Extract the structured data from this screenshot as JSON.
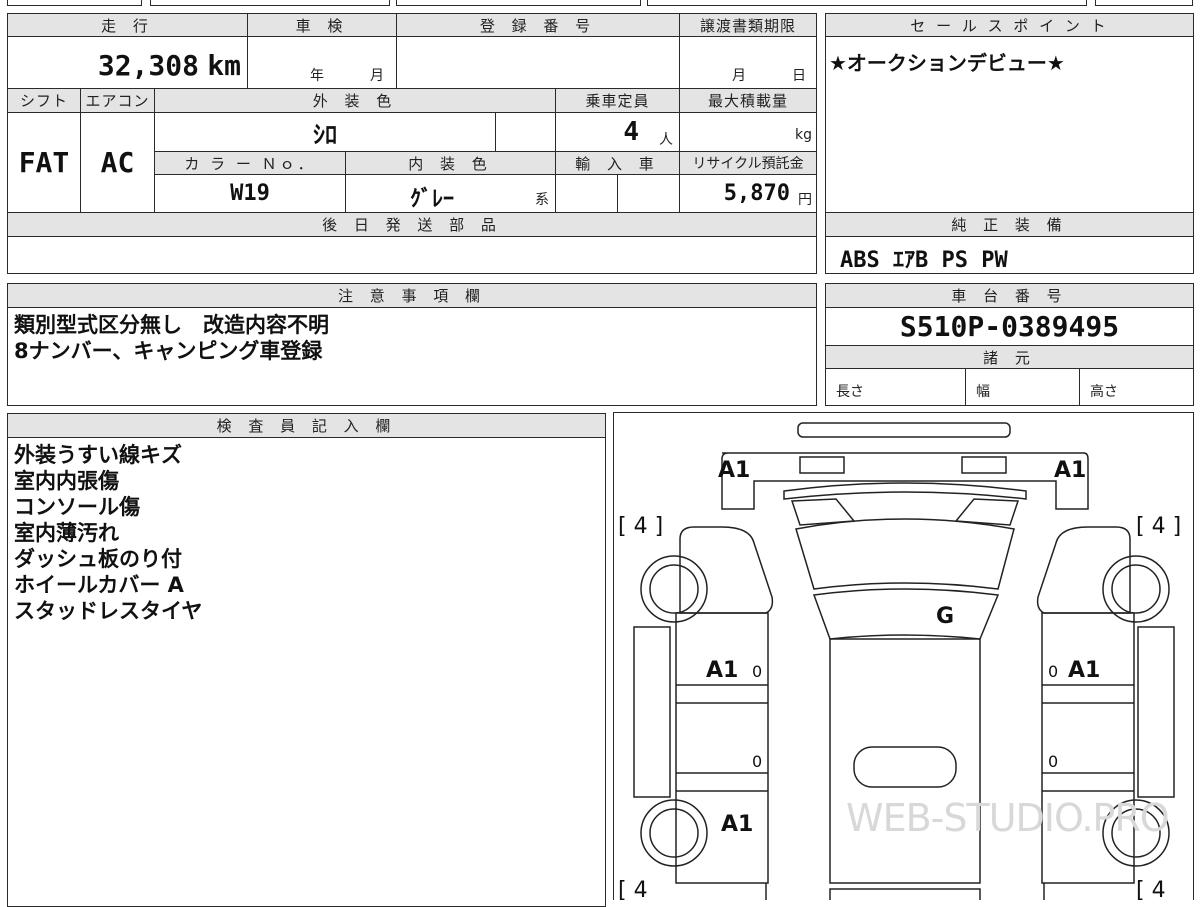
{
  "top_row": {
    "mileage_header": "走 行",
    "shaken_header": "車 検",
    "registration_header": "登 録 番 号",
    "deadline_header": "譲渡書類期限",
    "mileage_value": "32,308",
    "mileage_unit": "km",
    "shaken_year": "年",
    "shaken_month": "月",
    "deadline_month": "月",
    "deadline_day": "日"
  },
  "second_row": {
    "shift_header": "シフト",
    "ac_header": "エアコン",
    "exterior_color_header": "外 装 色",
    "capacity_header": "乗車定員",
    "max_load_header": "最大積載量",
    "shift_value": "FAT",
    "ac_value": "AC",
    "exterior_color_value": "ｼﾛ",
    "capacity_value": "4",
    "capacity_unit": "人",
    "max_load_unit": "kg",
    "color_no_header": "カ ラ ー Ｎｏ．",
    "interior_color_header": "内 装 色",
    "import_header": "輸 入 車",
    "recycle_header": "リサイクル預託金",
    "color_no_value": "W19",
    "interior_color_value": "ｸﾞﾚｰ",
    "interior_color_suffix": "系",
    "recycle_value": "5,870",
    "recycle_unit": "円"
  },
  "later_parts": {
    "header": "後 日 発 送 部 品",
    "value": ""
  },
  "sales_point": {
    "header": "セ ー ル ス ポ イ ン ト",
    "value": "★オークションデビュー★"
  },
  "genuine_equipment": {
    "header": "純 正 装 備",
    "value": "ABS ｴｱB PS PW"
  },
  "notes": {
    "header": "注 意 事 項 欄",
    "lines": [
      "類別型式区分無し　改造内容不明",
      "8ナンバー、キャンピング車登録"
    ]
  },
  "chassis": {
    "header": "車 台 番 号",
    "value": "S510P-0389495",
    "specs_header": "諸 元",
    "length_label": "長さ",
    "width_label": "幅",
    "height_label": "高さ"
  },
  "inspector": {
    "header": "検 査 員 記 入 欄",
    "lines": [
      "外装うすい線キズ",
      "室内内張傷",
      "コンソール傷",
      "室内薄汚れ",
      "ダッシュ板のり付",
      "ホイールカバー A",
      "スタッドレスタイヤ"
    ]
  },
  "diagram": {
    "marks": {
      "top_left": "A1",
      "top_right": "A1",
      "glass": "G",
      "left_door": "A1",
      "right_door": "A1",
      "left_rear": "A1",
      "tire_tl": "[ 4 ]",
      "tire_tr": "[ 4 ]",
      "tire_bl": "[ 4",
      "tire_br": "[ 4",
      "zero": "0"
    },
    "watermark": "WEB-STUDIO.PRO"
  }
}
